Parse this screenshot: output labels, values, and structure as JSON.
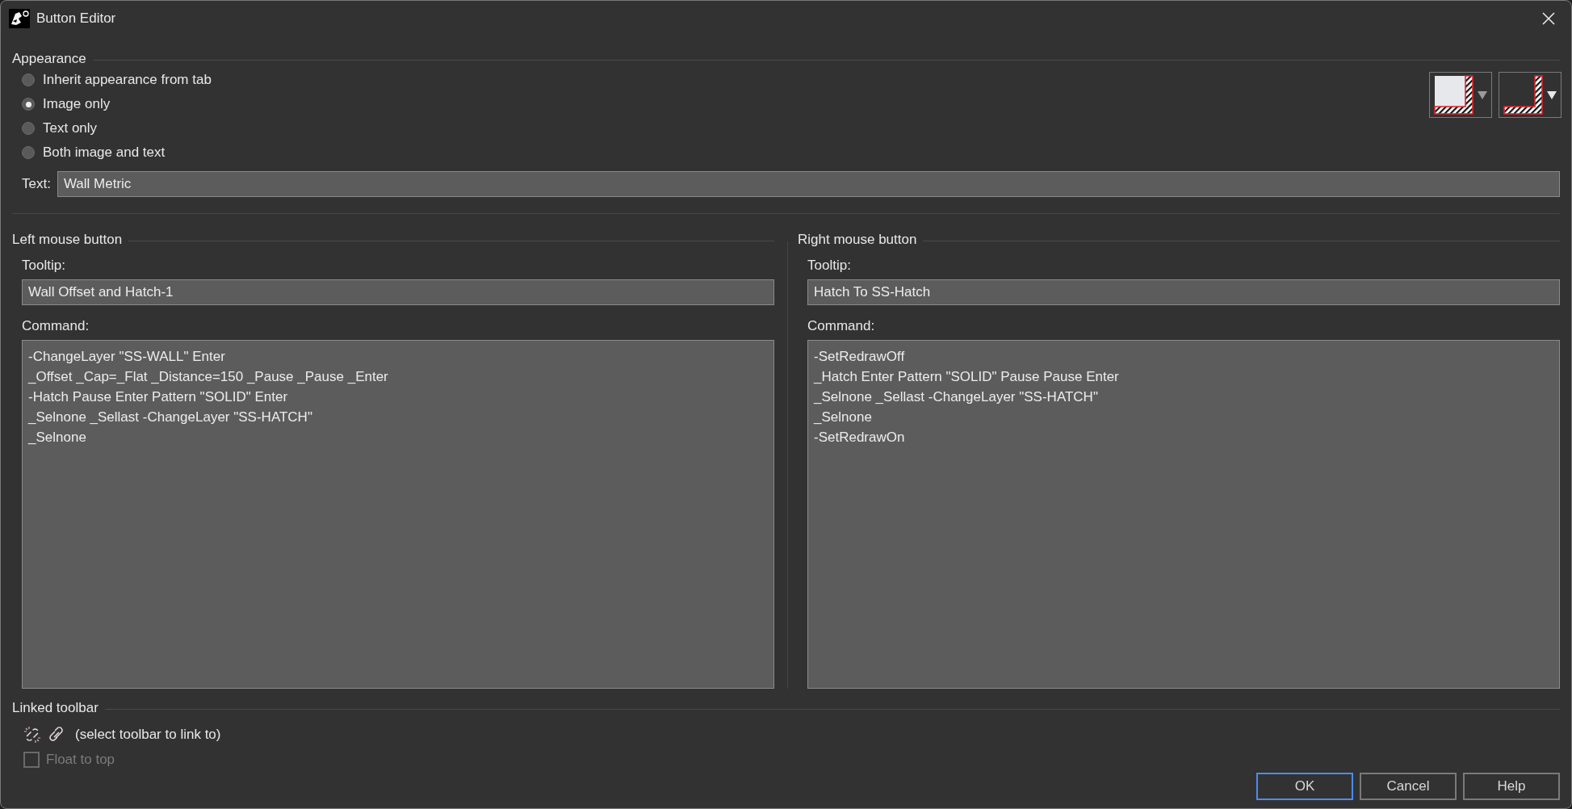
{
  "window": {
    "title": "Button Editor"
  },
  "appearance": {
    "heading": "Appearance",
    "options": [
      {
        "label": "Inherit appearance from tab",
        "selected": false
      },
      {
        "label": "Image only",
        "selected": true
      },
      {
        "label": "Text only",
        "selected": false
      },
      {
        "label": "Both image and text",
        "selected": false
      }
    ],
    "image_buttons": [
      {
        "kind": "large"
      },
      {
        "kind": "small"
      }
    ],
    "text_label": "Text:",
    "text_value": "Wall Metric"
  },
  "mouse_buttons": [
    {
      "heading": "Left mouse button",
      "tooltip_label": "Tooltip:",
      "tooltip_value": "Wall Offset and Hatch-1",
      "command_label": "Command:",
      "command_lines": [
        "-ChangeLayer \"SS-WALL\" Enter",
        "_Offset _Cap=_Flat _Distance=150 _Pause _Pause _Enter",
        "-Hatch Pause Enter Pattern \"SOLID\" Enter",
        "_Selnone _Sellast -ChangeLayer \"SS-HATCH\"",
        "_Selnone"
      ]
    },
    {
      "heading": "Right mouse button",
      "tooltip_label": "Tooltip:",
      "tooltip_value": "Hatch To SS-Hatch",
      "command_label": "Command:",
      "command_lines": [
        "-SetRedrawOff",
        "_Hatch Enter Pattern \"SOLID\" Pause Pause Enter",
        "_Selnone _Sellast -ChangeLayer \"SS-HATCH\"",
        "_Selnone",
        "-SetRedrawOn"
      ]
    }
  ],
  "linked_toolbar": {
    "heading": "Linked toolbar",
    "link_text": "(select toolbar to link to)",
    "float_to_top": {
      "label": "Float to top",
      "checked": false,
      "disabled": true
    }
  },
  "buttons": [
    {
      "label": "OK",
      "focused": true
    },
    {
      "label": "Cancel",
      "focused": false
    },
    {
      "label": "Help",
      "focused": false
    }
  ]
}
